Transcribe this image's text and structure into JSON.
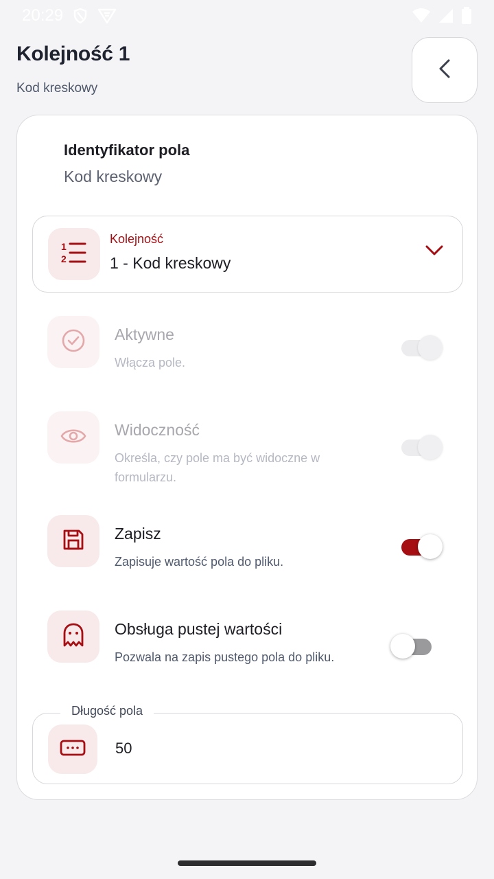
{
  "status_bar": {
    "time": "20:29"
  },
  "header": {
    "title": "Kolejność 1",
    "subtitle": "Kod kreskowy"
  },
  "field_identifier": {
    "label": "Identyfikator pola",
    "value": "Kod kreskowy"
  },
  "order_dropdown": {
    "label": "Kolejność",
    "value": "1 - Kod kreskowy",
    "icon": "numbered-list-icon"
  },
  "settings": [
    {
      "title": "Aktywne",
      "description": "Włącza pole.",
      "icon": "check-circle-icon",
      "enabled": false,
      "toggle_on": true
    },
    {
      "title": "Widoczność",
      "description": "Określa, czy pole ma być widoczne w formularzu.",
      "icon": "eye-icon",
      "enabled": false,
      "toggle_on": true
    },
    {
      "title": "Zapisz",
      "description": "Zapisuje wartość pola do pliku.",
      "icon": "save-icon",
      "enabled": true,
      "toggle_on": true
    },
    {
      "title": "Obsługa pustej wartości",
      "description": "Pozwala na zapis pustego pola do pliku.",
      "icon": "ghost-icon",
      "enabled": true,
      "toggle_on": false
    }
  ],
  "field_length": {
    "label": "Długość pola",
    "value": "50",
    "icon": "input-dots-icon"
  },
  "colors": {
    "accent": "#a50e12",
    "icon_bg": "#f8e9ea",
    "background": "#f4f4f6"
  }
}
